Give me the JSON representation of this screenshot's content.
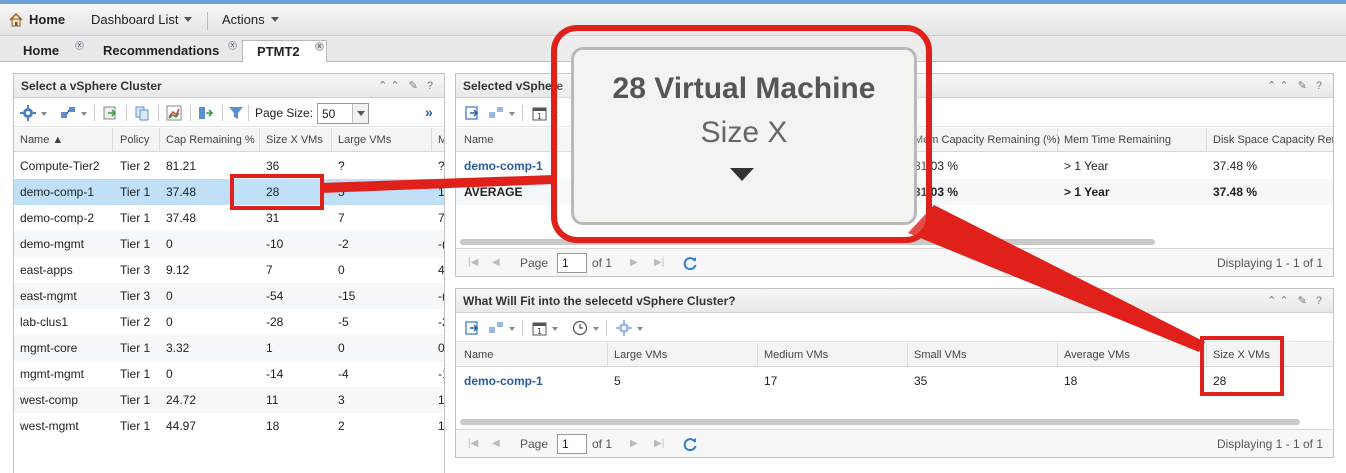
{
  "topbar": {
    "home": "Home",
    "dashboard_list": "Dashboard List",
    "actions": "Actions"
  },
  "tabs": [
    {
      "label": "Home"
    },
    {
      "label": "Recommendations"
    },
    {
      "label": "PTMT2"
    }
  ],
  "left_panel": {
    "title": "Select a vSphere Cluster",
    "page_size_label": "Page Size:",
    "page_size_value": "50",
    "columns": [
      "Name",
      "Policy",
      "Cap Remaining %",
      "Size X VMs",
      "Large VMs",
      "M"
    ],
    "rows": [
      [
        "Compute-Tier2",
        "Tier 2",
        "81.21",
        "36",
        "?",
        "?"
      ],
      [
        "demo-comp-1",
        "Tier 1",
        "37.48",
        "28",
        "5",
        "1"
      ],
      [
        "demo-comp-2",
        "Tier 1",
        "37.48",
        "31",
        "7",
        "7"
      ],
      [
        "demo-mgmt",
        "Tier 1",
        "0",
        "-10",
        "-2",
        "-("
      ],
      [
        "east-apps",
        "Tier 3",
        "9.12",
        "7",
        "0",
        "4"
      ],
      [
        "east-mgmt",
        "Tier 3",
        "0",
        "-54",
        "-15",
        "-("
      ],
      [
        "lab-clus1",
        "Tier 2",
        "0",
        "-28",
        "-5",
        "-2"
      ],
      [
        "mgmt-core",
        "Tier 1",
        "3.32",
        "1",
        "0",
        "0"
      ],
      [
        "mgmt-mgmt",
        "Tier 1",
        "0",
        "-14",
        "-4",
        "-1"
      ],
      [
        "west-comp",
        "Tier 1",
        "24.72",
        "11",
        "3",
        "1"
      ],
      [
        "west-mgmt",
        "Tier 1",
        "44.97",
        "18",
        "2",
        "1"
      ]
    ]
  },
  "top_right_panel": {
    "title": "Selected vSphere",
    "columns": [
      "Name",
      "Mem Capacity Remaining (%)",
      "Mem Time Remaining",
      "Disk Space Capacity Rema"
    ],
    "rows": [
      [
        "demo-comp-1",
        "31.03 %",
        "> 1 Year",
        "37.48 %"
      ],
      [
        "AVERAGE",
        "31.03 %",
        "> 1 Year",
        "37.48 %"
      ]
    ],
    "pager": {
      "page_label": "Page",
      "page_value": "1",
      "of_label": "of 1",
      "displaying": "Displaying 1 - 1 of 1"
    }
  },
  "bottom_right_panel": {
    "title": "What Will Fit into the selecetd vSphere Cluster?",
    "columns": [
      "Name",
      "Large VMs",
      "Medium VMs",
      "Small VMs",
      "Average VMs",
      "Size X VMs"
    ],
    "rows": [
      [
        "demo-comp-1",
        "5",
        "17",
        "35",
        "18",
        "28"
      ]
    ],
    "pager": {
      "page_label": "Page",
      "page_value": "1",
      "of_label": "of 1",
      "displaying": "Displaying 1 - 1 of 1"
    }
  },
  "callout": {
    "title": "28 Virtual Machine",
    "subtitle": "Size X"
  },
  "colors": {
    "annotation_red": "#e0201a",
    "selected_row": "#bfe0f7",
    "link_blue": "#2a5d9f"
  },
  "icons": [
    "home-icon",
    "gear-icon",
    "export-icon",
    "calendar-icon",
    "clock-icon",
    "filter-icon",
    "refresh-icon",
    "chart-icon",
    "double-chevron-right-icon"
  ]
}
